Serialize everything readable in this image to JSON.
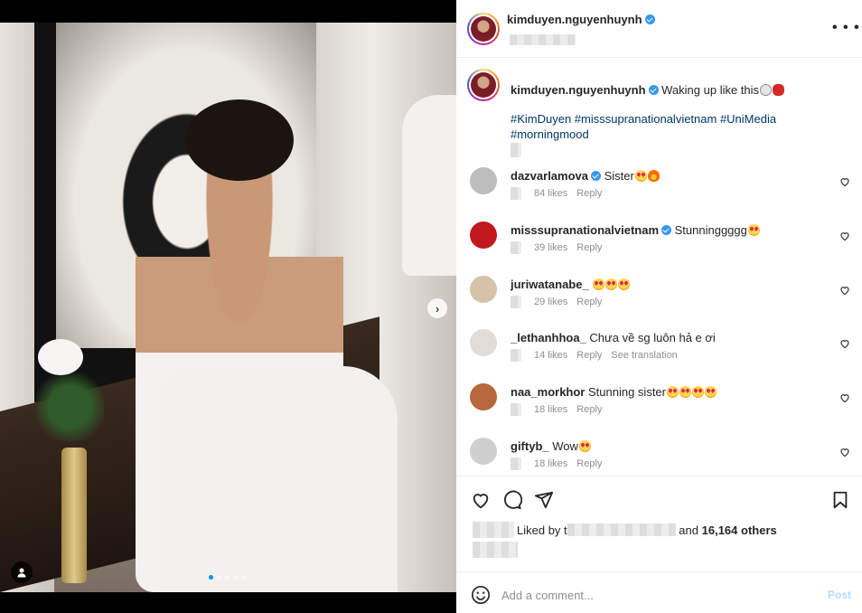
{
  "post": {
    "author": "kimduyen.nguyenhuynh",
    "caption_text": "Waking up like this",
    "hashtags": "#KimDuyen #misssupranationalvietnam #UniMedia #morningmood",
    "media_index": 1,
    "media_count": 5
  },
  "comments": [
    {
      "username": "dazvarlamova",
      "verified": true,
      "text": "Sister",
      "emojis": [
        "heart-eyes",
        "fire"
      ],
      "likes": "84 likes",
      "reply": "Reply",
      "translate": ""
    },
    {
      "username": "misssupranationalvietnam",
      "verified": true,
      "text": "Stunninggggg",
      "emojis": [
        "heart-eyes"
      ],
      "likes": "39 likes",
      "reply": "Reply",
      "translate": ""
    },
    {
      "username": "juriwatanabe_",
      "verified": false,
      "text": "",
      "emojis": [
        "heart-eyes",
        "heart-eyes",
        "heart-eyes"
      ],
      "likes": "29 likes",
      "reply": "Reply",
      "translate": ""
    },
    {
      "username": "_lethanhhoa_",
      "verified": false,
      "text": "Chưa về sg luôn hả e ơi",
      "emojis": [],
      "likes": "14 likes",
      "reply": "Reply",
      "translate": "See translation"
    },
    {
      "username": "naa_morkhor",
      "verified": false,
      "text": "Stunning sister",
      "emojis": [
        "heart-eyes",
        "heart-eyes",
        "heart-eyes",
        "heart-eyes"
      ],
      "likes": "18 likes",
      "reply": "Reply",
      "translate": ""
    },
    {
      "username": "giftyb_",
      "verified": false,
      "text": "Wow",
      "emojis": [
        "heart-eyes"
      ],
      "likes": "18 likes",
      "reply": "Reply",
      "translate": ""
    }
  ],
  "likes": {
    "prefix": "Liked by",
    "lead_char": "t",
    "conjunction": "and",
    "count_text": "16,164 others"
  },
  "add_comment": {
    "placeholder": "Add a comment...",
    "post_label": "Post"
  },
  "colors": {
    "link": "#00376b",
    "verified": "#3897f0",
    "post_disabled": "#b3dbff",
    "dot_active": "#0095f6"
  }
}
